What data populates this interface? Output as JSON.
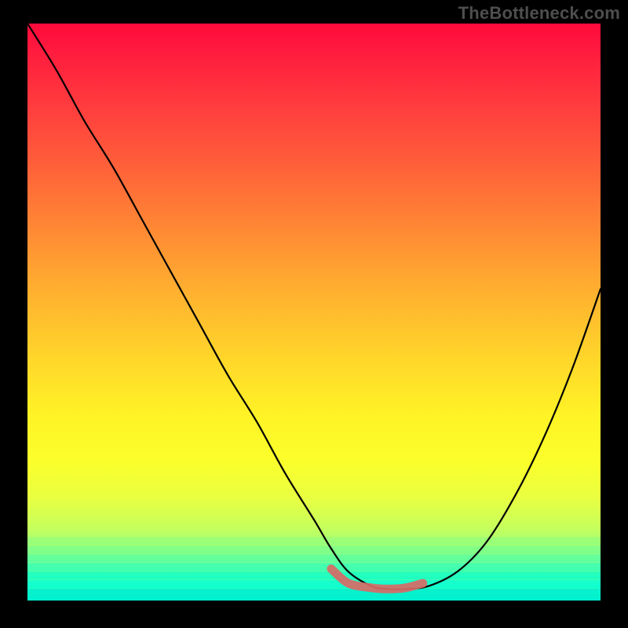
{
  "watermark": "TheBottleneck.com",
  "colors": {
    "frame_bg": "#000000",
    "curve_stroke": "#000000",
    "accent_stroke": "#d86a66",
    "watermark_text": "#4e4e4e"
  },
  "chart_data": {
    "type": "line",
    "title": "",
    "xlabel": "",
    "ylabel": "",
    "xlim": [
      0,
      100
    ],
    "ylim": [
      0,
      100
    ],
    "series": [
      {
        "name": "bottleneck-curve",
        "x": [
          0,
          5,
          10,
          15,
          20,
          25,
          30,
          35,
          40,
          45,
          50,
          53,
          56,
          60,
          63,
          66,
          70,
          75,
          80,
          85,
          90,
          95,
          100
        ],
        "y": [
          100,
          92,
          83,
          75,
          66,
          57,
          48,
          39,
          31,
          22,
          14,
          9,
          5,
          2.5,
          2,
          2,
          2.5,
          5,
          10,
          18,
          28,
          40,
          54
        ]
      }
    ],
    "highlight_segment": {
      "name": "low-bottleneck-band",
      "x": [
        53,
        56,
        60,
        63,
        66,
        69
      ],
      "y": [
        5.5,
        3,
        2.2,
        2,
        2.2,
        3
      ]
    },
    "gradient_stops": [
      {
        "pos": 0.0,
        "color": "#ff0a3c"
      },
      {
        "pos": 0.25,
        "color": "#ff6139"
      },
      {
        "pos": 0.5,
        "color": "#ffc42c"
      },
      {
        "pos": 0.7,
        "color": "#fff326"
      },
      {
        "pos": 0.88,
        "color": "#b4ff66"
      },
      {
        "pos": 1.0,
        "color": "#00ffcd"
      }
    ]
  }
}
